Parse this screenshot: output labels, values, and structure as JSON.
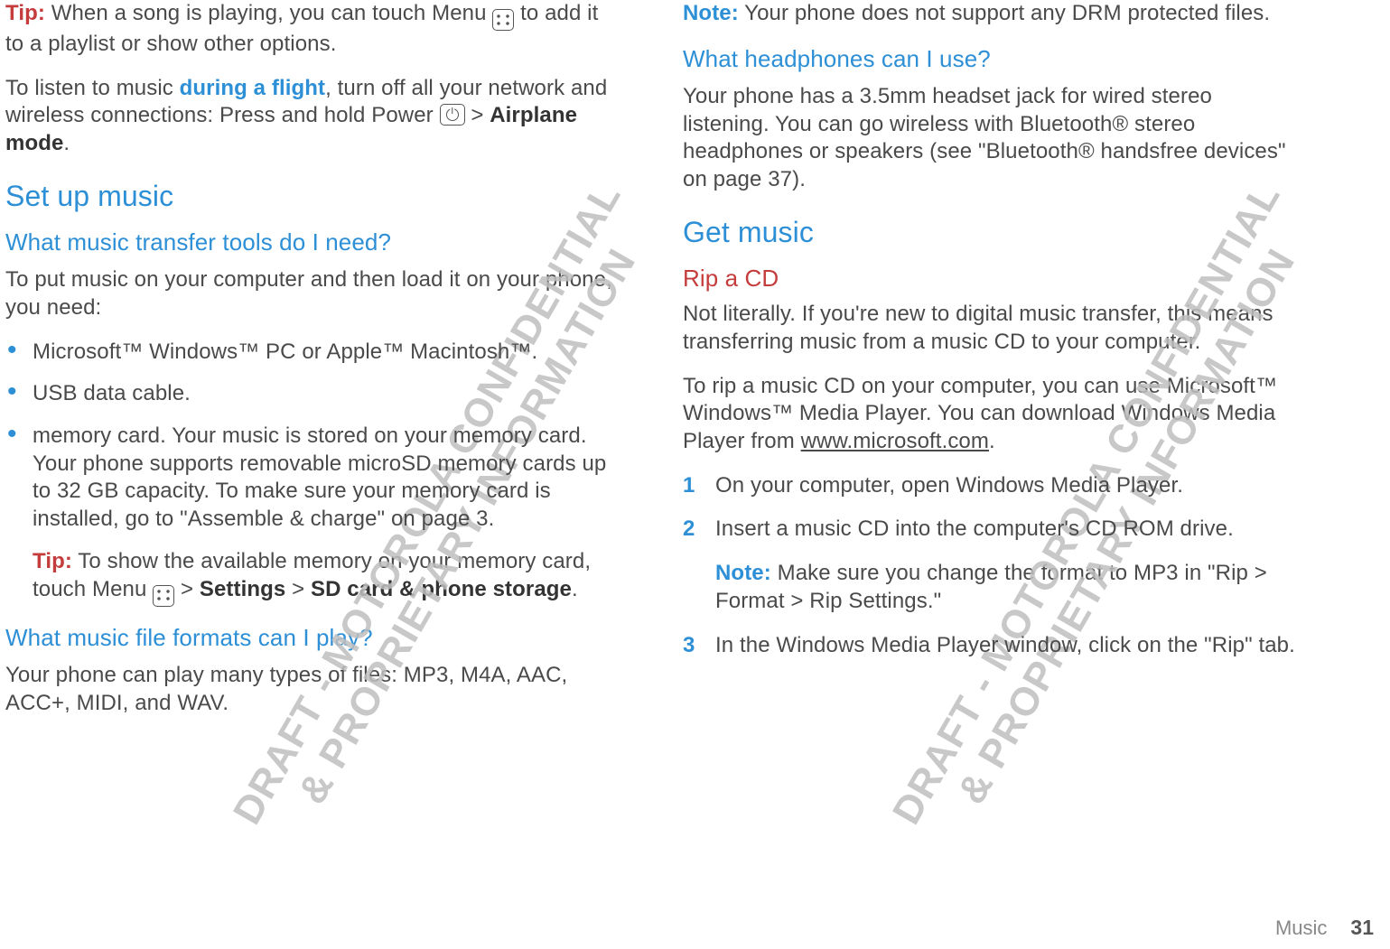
{
  "watermark_text": "DRAFT - MOTOROLA CONFIDENTIAL\n& PROPRIETARY INFORMATION",
  "footer": {
    "section": "Music",
    "page": "31"
  },
  "left": {
    "tip1_label": "Tip:",
    "tip1_text_a": " When a song is playing, you can touch Menu ",
    "tip1_text_b": " to add it to a playlist or show other options.",
    "flight_a": "To listen to music ",
    "flight_bold": "during a flight",
    "flight_b": ", turn off all your network and wireless connections: Press and hold Power ",
    "flight_c": " > ",
    "flight_d": "Airplane mode",
    "flight_e": ".",
    "h2_setup": "Set up music",
    "h3_tools": "What music transfer tools do I need?",
    "tools_intro": "To put music on your computer and then load it on your phone, you need:",
    "bullet1": "Microsoft™ Windows™ PC or Apple™ Macintosh™.",
    "bullet2": "USB data cable.",
    "bullet3": "memory card. Your music is stored on your memory card. Your phone supports removable microSD memory cards up to 32 GB capacity. To make sure your memory card is installed, go to \"Assemble & charge\" on page 3.",
    "subtip_label": "Tip:",
    "subtip_a": " To show the available memory on your memory card, touch Menu ",
    "subtip_b": " > ",
    "subtip_c": "Settings",
    "subtip_d": " > ",
    "subtip_e": "SD card & phone storage",
    "subtip_f": ".",
    "h3_formats": "What music file formats can I play?",
    "formats_text": "Your phone can play many types of files: MP3, M4A, AAC, ACC+, MIDI, and WAV."
  },
  "right": {
    "note_label": "Note:",
    "note_text": " Your phone does not support any DRM protected files.",
    "h3_headphones": "What headphones can I use?",
    "headphones_text": "Your phone has a 3.5mm headset jack for wired stereo listening. You can go wireless with Bluetooth® stereo headphones or speakers (see \"Bluetooth® handsfree devices\" on page 37).",
    "h2_get": "Get music",
    "h3_rip": "Rip a CD",
    "rip_p1": "Not literally. If you're new to digital music transfer, this means transferring music from a music CD to your computer.",
    "rip_p2_a": "To rip a music CD on your computer, you can use Microsoft™ Windows™ Media Player. You can download Windows Media Player from ",
    "rip_p2_link": "www.microsoft.com",
    "rip_p2_b": ".",
    "step1": "On your computer, open Windows Media Player.",
    "step2": "Insert a music CD into the computer's CD ROM drive.",
    "subnote_label": "Note:",
    "subnote_text": " Make sure you change the format to MP3 in \"Rip > Format > Rip Settings.\"",
    "step3": "In the Windows Media Player window, click on the \"Rip\" tab."
  }
}
